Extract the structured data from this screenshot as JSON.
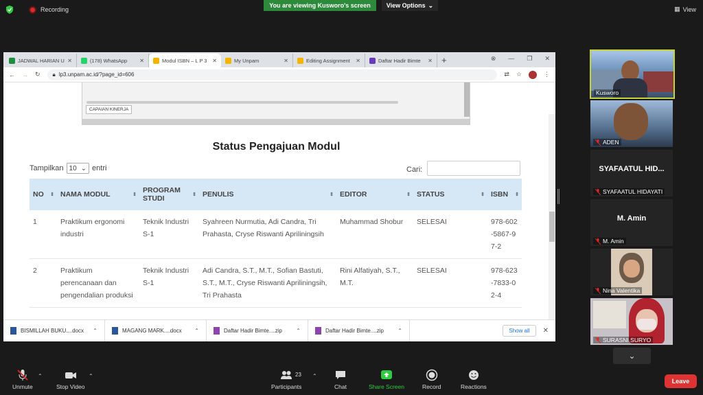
{
  "zoom": {
    "recording_label": "Recording",
    "viewing_banner": "You are viewing Kusworo's screen",
    "view_options_label": "View Options",
    "view_label": "View",
    "toolbar": {
      "unmute": "Unmute",
      "stop_video": "Stop Video",
      "participants": "Participants",
      "participants_count": "23",
      "chat": "Chat",
      "share_screen": "Share Screen",
      "record": "Record",
      "reactions": "Reactions",
      "leave": "Leave"
    },
    "participants": [
      {
        "name": "Kusworo",
        "video": true
      },
      {
        "name": "ADEN",
        "video": true
      },
      {
        "name": "SYAFAATUL HIDAYATI",
        "display": "SYAFAATUL HID...",
        "video": false
      },
      {
        "name": "M. Amin",
        "display": "M. Amin",
        "video": false
      },
      {
        "name": "Nina Valentika",
        "video": true
      },
      {
        "name": "SURASNI SURYO",
        "video": true
      }
    ]
  },
  "browser": {
    "tabs": [
      {
        "title": "JADWAL HARIAN U",
        "color": "#1e8e3e"
      },
      {
        "title": "(178) WhatsApp",
        "color": "#25d366"
      },
      {
        "title": "Modul ISBN – L P 3",
        "color": "#f4b400"
      },
      {
        "title": "My Unpam",
        "color": "#f4b400"
      },
      {
        "title": "Editing Assignment",
        "color": "#f4b400"
      },
      {
        "title": "Daftar Hadir Bimte",
        "color": "#673ab7"
      }
    ],
    "url": "lp3.unpam.ac.id/?page_id=606",
    "embed_button": "CAPAIAN KINERJA",
    "page_title": "Status Pengajuan Modul",
    "show_label": "Tampilkan",
    "show_value": "10",
    "entries_label": "entri",
    "search_label": "Cari:",
    "table": {
      "headers": [
        "NO",
        "NAMA MODUL",
        "PROGRAM STUDI",
        "PENULIS",
        "EDITOR",
        "STATUS",
        "ISBN"
      ],
      "rows": [
        {
          "no": "1",
          "nama": "Praktikum ergonomi industri",
          "prodi": "Teknik Industri S-1",
          "penulis": "Syahreen Nurmutia, Adi Candra, Tri Prahasta, Cryse Riswanti Apriliningsih",
          "editor": "Muhammad Shobur",
          "status": "SELESAI",
          "isbn": "978-602-5867-97-2"
        },
        {
          "no": "2",
          "nama": "Praktikum perencanaan dan pengendalian produksi",
          "prodi": "Teknik Industri S-1",
          "penulis": "Adi Candra, S.T., M.T., Sofian Bastuti, S.T., M.T., Cryse Riswanti Apriliningsih, Tri Prahasta",
          "editor": "Rini Alfatiyah, S.T., M.T.",
          "status": "SELESAI",
          "isbn": "978-623-7833-02-4"
        }
      ]
    },
    "downloads": [
      {
        "name": "BISMILLAH BUKU....docx",
        "color": "#2b579a"
      },
      {
        "name": "MAGANG MARK....docx",
        "color": "#2b579a"
      },
      {
        "name": "Daftar Hadir Bimte....zip",
        "color": "#8e44ad"
      },
      {
        "name": "Daftar Hadir Bimte....zip",
        "color": "#8e44ad"
      }
    ],
    "show_all": "Show all"
  }
}
